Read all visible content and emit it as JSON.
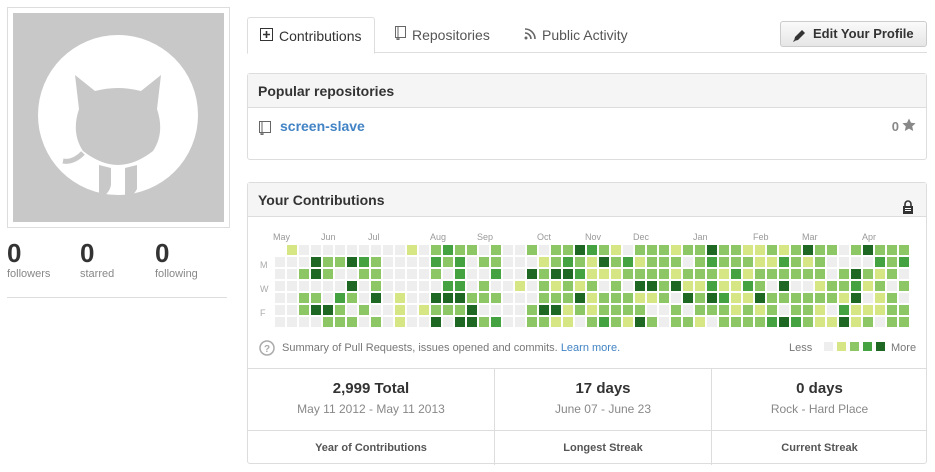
{
  "profile": {
    "stats": [
      {
        "count": "0",
        "label": "followers"
      },
      {
        "count": "0",
        "label": "starred"
      },
      {
        "count": "0",
        "label": "following"
      }
    ]
  },
  "tabs": [
    {
      "label": "Contributions",
      "icon": "contributions-icon",
      "selected": true
    },
    {
      "label": "Repositories",
      "icon": "repo-icon",
      "selected": false
    },
    {
      "label": "Public Activity",
      "icon": "rss-icon",
      "selected": false
    }
  ],
  "edit_profile_label": "Edit Your Profile",
  "popular": {
    "title": "Popular repositories",
    "repos": [
      {
        "name": "screen-slave",
        "stars": "0"
      }
    ]
  },
  "contributions": {
    "title": "Your Contributions",
    "months": [
      "May",
      "Jun",
      "Jul",
      "Aug",
      "Sep",
      "Oct",
      "Nov",
      "Dec",
      "Jan",
      "Feb",
      "Mar",
      "Apr"
    ],
    "day_labels": [
      "M",
      "W",
      "F"
    ],
    "summary_text": "Summary of Pull Requests, issues opened and commits.",
    "learn_more": "Learn more.",
    "less_label": "Less",
    "more_label": "More",
    "colors": [
      "#eeeeee",
      "#d6e685",
      "#8cc665",
      "#44a340",
      "#1e6823"
    ],
    "totals": [
      {
        "big": "2,999 Total",
        "sub": "May 11 2012 - May 11 2013",
        "foot": "Year of Contributions"
      },
      {
        "big": "17 days",
        "sub": "June 07 - June 23",
        "foot": "Longest Streak"
      },
      {
        "big": "0 days",
        "sub": "Rock - Hard Place",
        "foot": "Current Streak"
      }
    ]
  }
}
